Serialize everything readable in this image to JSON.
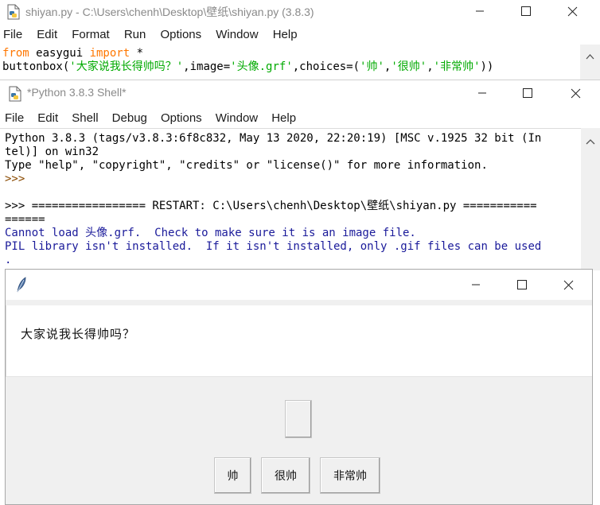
{
  "editor": {
    "title": "shiyan.py - C:\\Users\\chenh\\Desktop\\壁纸\\shiyan.py (3.8.3)",
    "menus": [
      "File",
      "Edit",
      "Format",
      "Run",
      "Options",
      "Window",
      "Help"
    ],
    "line1": {
      "kw1": "from",
      "mod": " easygui ",
      "kw2": "import",
      "rest": " *"
    },
    "line2": {
      "a": "buttonbox(",
      "s1": "'大家说我长得帅吗？'",
      "b": ",image=",
      "s2": "'头像.grf'",
      "c": ",choices=(",
      "s3": "'帅'",
      "d": ",",
      "s4": "'很帅'",
      "e": ",",
      "s5": "'非常帅'",
      "f": "))"
    }
  },
  "shell": {
    "title": "*Python 3.8.3 Shell*",
    "menus": [
      "File",
      "Edit",
      "Shell",
      "Debug",
      "Options",
      "Window",
      "Help"
    ],
    "lines": {
      "l1": "Python 3.8.3 (tags/v3.8.3:6f8c832, May 13 2020, 22:20:19) [MSC v.1925 32 bit (In",
      "l2": "tel)] on win32",
      "l3": "Type \"help\", \"copyright\", \"credits\" or \"license()\" for more information.",
      "l4": ">>>",
      "l5": ">>> ================= RESTART: C:\\Users\\chenh\\Desktop\\壁纸\\shiyan.py ===========",
      "l6": "======",
      "l7": "Cannot load 头像.grf.  Check to make sure it is an image file.",
      "l8": "PIL library isn't installed.  If it isn't installed, only .gif files can be used",
      "l9": "."
    }
  },
  "dialog": {
    "message": "大家说我长得帅吗？",
    "choices": [
      "帅",
      "很帅",
      "非常帅"
    ]
  },
  "icons": {
    "python-file": "python-file-icon",
    "feather": "tk-feather-icon",
    "minimize": "minimize-icon",
    "maximize": "maximize-icon",
    "close": "close-icon"
  },
  "colors": {
    "keyword": "#ff7700",
    "string": "#00aa00",
    "output": "#1a1a9a",
    "dialog_bg": "#f0f0f0"
  },
  "glyphs": {
    "minimize": "—",
    "maximize": "☐",
    "close": "✕"
  }
}
